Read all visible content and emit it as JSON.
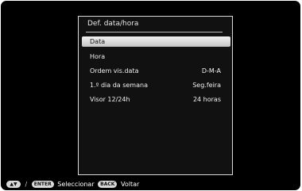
{
  "menu": {
    "title": "Def. data/hora",
    "items": [
      {
        "label": "Data",
        "value": "",
        "selected": true
      },
      {
        "label": "Hora",
        "value": "",
        "selected": false
      },
      {
        "label": "Ordem vis.data",
        "value": "D-M-A",
        "selected": false
      },
      {
        "label": "1.º dia da semana",
        "value": "Seg.feira",
        "selected": false
      },
      {
        "label": "Visor 12/24h",
        "value": "24 horas",
        "selected": false
      }
    ]
  },
  "footer": {
    "nav_icon": "up-down-arrows-icon",
    "separator": "/",
    "enter_key": "ENTER",
    "enter_label": "Seleccionar",
    "back_key": "BACK",
    "back_label": "Voltar"
  },
  "colors": {
    "background": "#000000",
    "panel_border": "#d8d8d8",
    "highlight": "#d9d9d9"
  }
}
